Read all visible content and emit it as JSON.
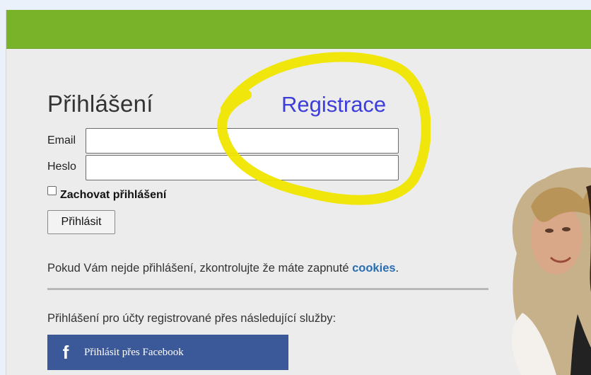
{
  "colors": {
    "header_bar": "#79b32a",
    "highlight": "#f0e600",
    "link": "#3d3dd9",
    "cookies_link": "#2a6db0",
    "facebook": "#3b5998"
  },
  "login": {
    "title": "Přihlášení",
    "register_link": "Registrace",
    "email_label": "Email",
    "email_value": "",
    "password_label": "Heslo",
    "password_value": "",
    "remember_checked": false,
    "remember_label": "Zachovat přihlášení",
    "submit_label": "Přihlásit"
  },
  "info": {
    "text": "Pokud Vám nejde přihlášení, zkontrolujte že máte zapnuté ",
    "cookies_link": "cookies",
    "end": "."
  },
  "services": {
    "text": "Přihlášení pro účty registrované přes následující služby:",
    "facebook_icon": "f",
    "facebook_label": "Přihlásit přes Facebook"
  },
  "icons": {
    "facebook": "facebook-icon"
  }
}
